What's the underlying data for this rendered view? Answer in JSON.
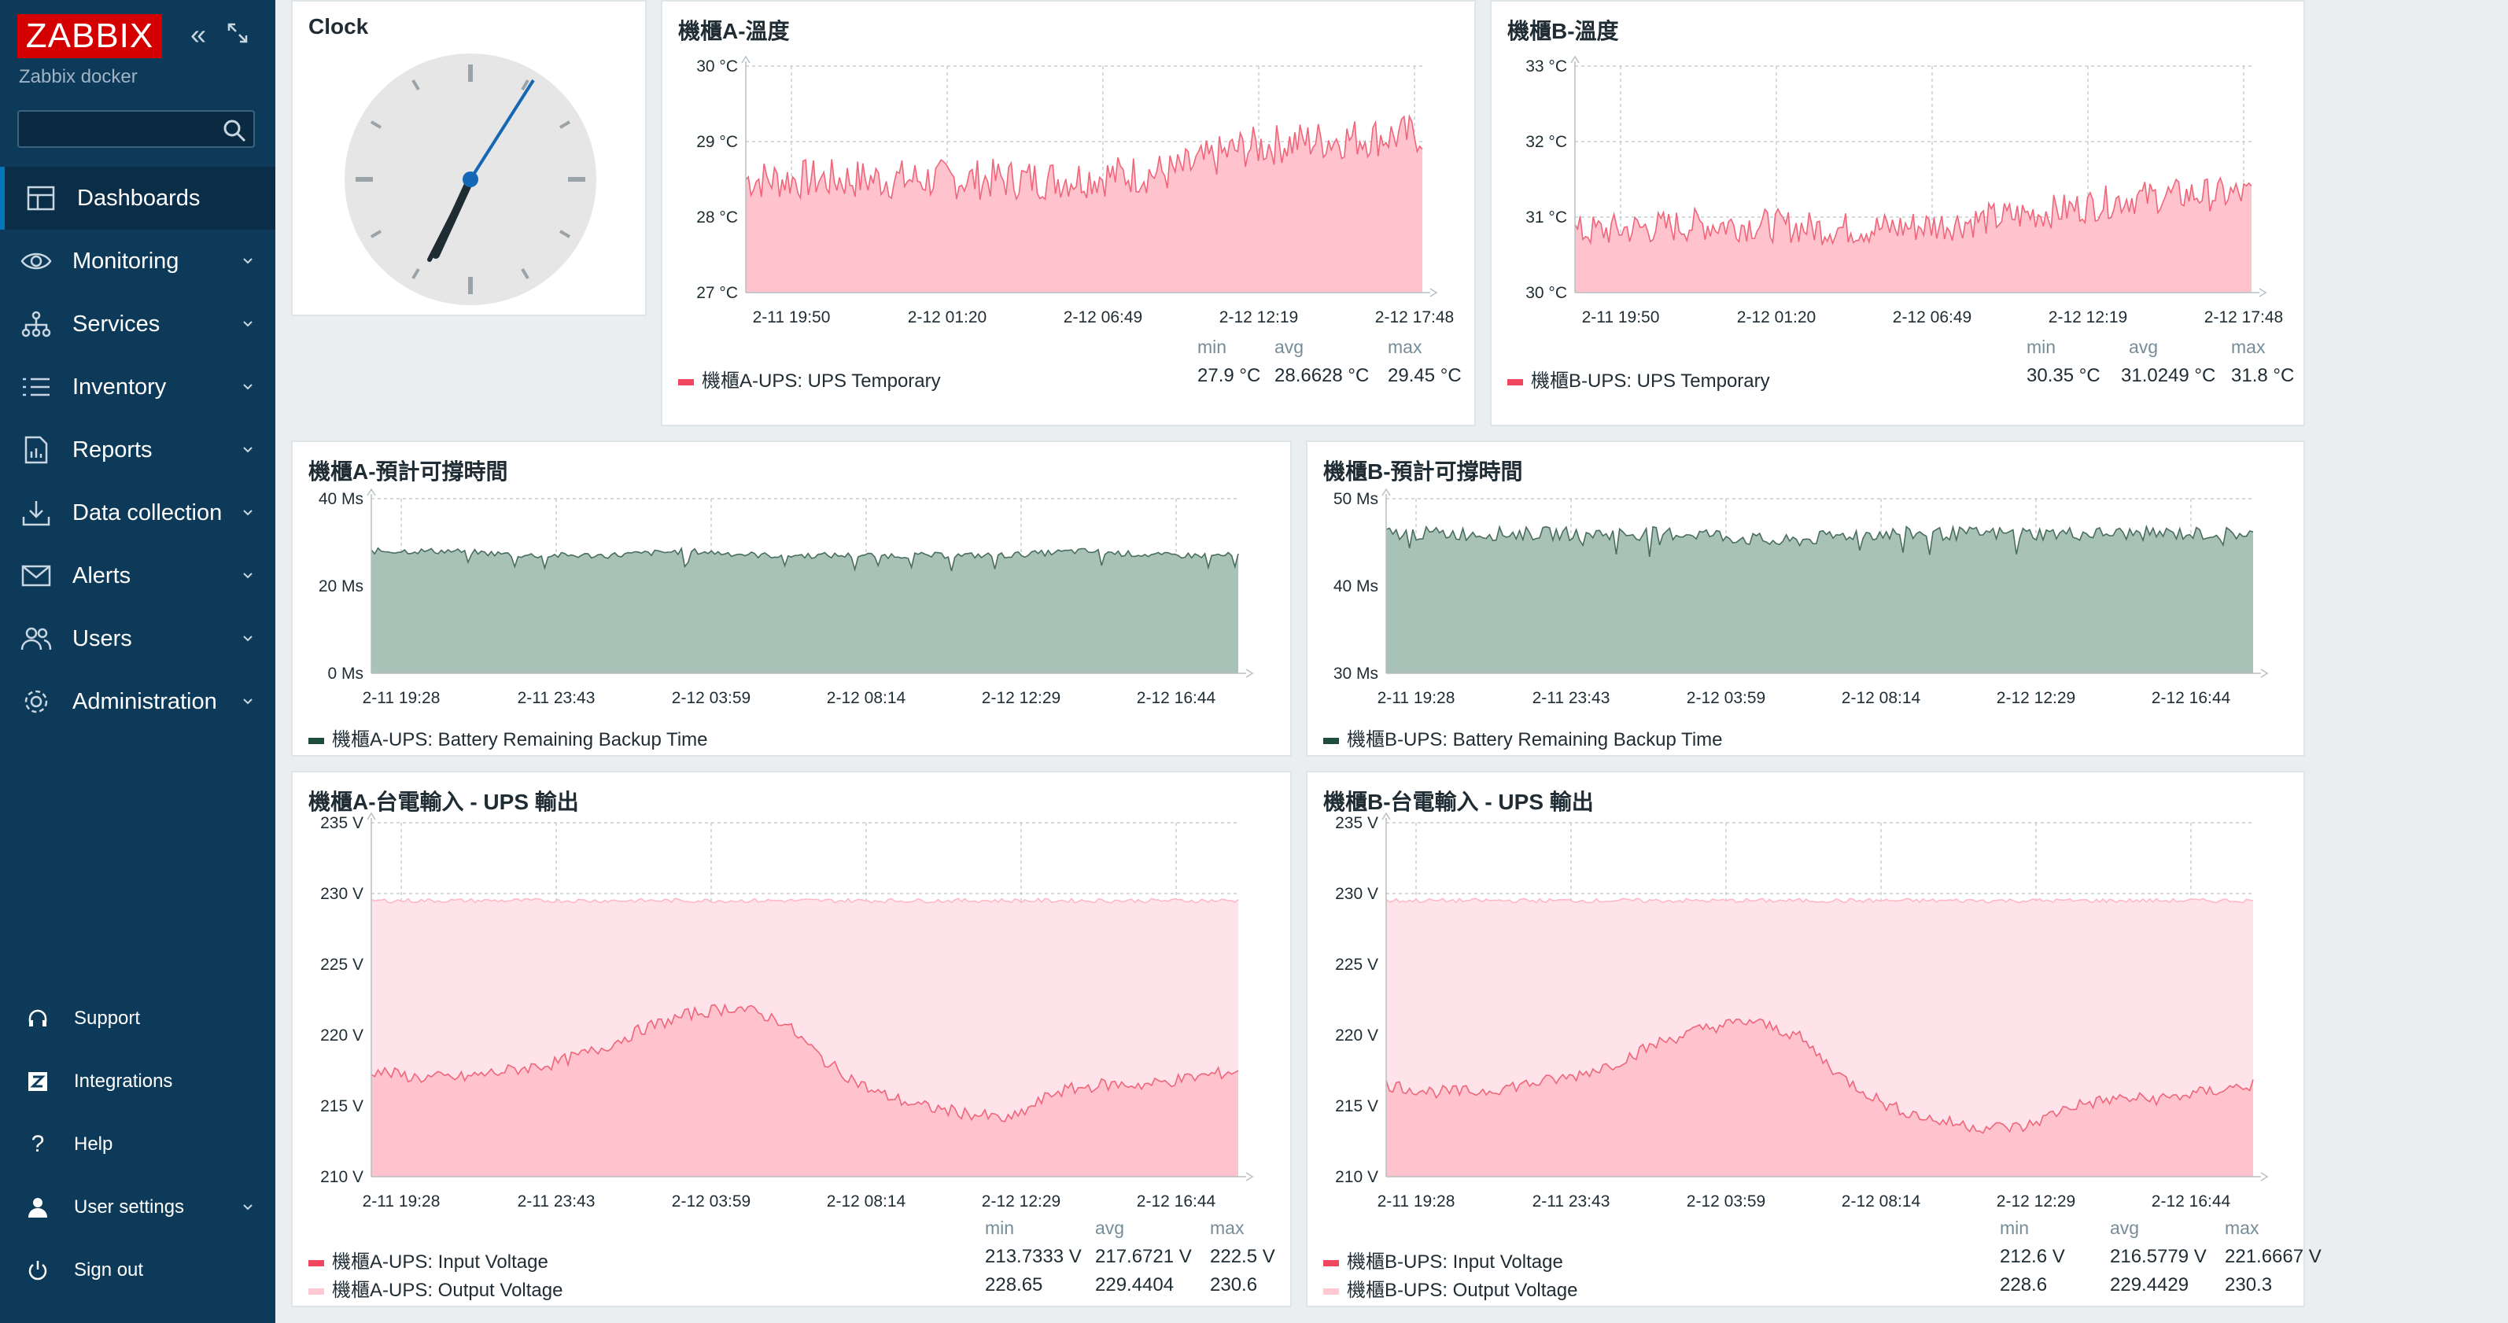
{
  "brand": {
    "logo": "ZABBIX",
    "server_name": "Zabbix docker"
  },
  "sidebar": {
    "search_placeholder": "",
    "menu": [
      {
        "label": "Dashboards",
        "icon": "dashboard-icon"
      },
      {
        "label": "Monitoring",
        "icon": "eye-icon"
      },
      {
        "label": "Services",
        "icon": "services-icon"
      },
      {
        "label": "Inventory",
        "icon": "list-icon"
      },
      {
        "label": "Reports",
        "icon": "report-icon"
      },
      {
        "label": "Data collection",
        "icon": "download-icon"
      },
      {
        "label": "Alerts",
        "icon": "envelope-icon"
      },
      {
        "label": "Users",
        "icon": "users-icon"
      },
      {
        "label": "Administration",
        "icon": "gear-icon"
      }
    ],
    "footer": [
      {
        "label": "Support",
        "icon": "headset-icon"
      },
      {
        "label": "Integrations",
        "icon": "integrations-icon"
      },
      {
        "label": "Help",
        "icon": "help-icon"
      },
      {
        "label": "User settings",
        "icon": "user-icon"
      },
      {
        "label": "Sign out",
        "icon": "power-icon"
      }
    ]
  },
  "colors": {
    "sidebar": "#0e3a5a",
    "accent_red": "#d40000",
    "temp_line": "#f0657a",
    "temp_fill": "#ffc3cd",
    "backup_line": "#4a6e5e",
    "backup_fill": "#a8c2b7",
    "output_fill": "#ffe3ea",
    "input_fill": "#ffc3cd"
  },
  "clock": {
    "title": "Clock"
  },
  "widgets": {
    "tempA": {
      "title": "機櫃A-溫度",
      "yticks": [
        "30 °C",
        "29 °C",
        "28 °C",
        "27 °C"
      ],
      "xticks": [
        "2-11 19:50",
        "2-12 01:20",
        "2-12 06:49",
        "2-12 12:19",
        "2-12 17:48"
      ],
      "legend": [
        "機櫃A-UPS: UPS Temporary"
      ],
      "stat_headers": [
        "min",
        "avg",
        "max"
      ],
      "stats": [
        [
          "27.9 °C",
          "28.6628 °C",
          "29.45 °C"
        ]
      ]
    },
    "tempB": {
      "title": "機櫃B-溫度",
      "yticks": [
        "33 °C",
        "32 °C",
        "31 °C",
        "30 °C"
      ],
      "xticks": [
        "2-11 19:50",
        "2-12 01:20",
        "2-12 06:49",
        "2-12 12:19",
        "2-12 17:48"
      ],
      "legend": [
        "機櫃B-UPS: UPS Temporary"
      ],
      "stat_headers": [
        "min",
        "avg",
        "max"
      ],
      "stats": [
        [
          "30.35 °C",
          "31.0249 °C",
          "31.8 °C"
        ]
      ]
    },
    "backupA": {
      "title": "機櫃A-預計可撐時間",
      "yticks": [
        "40 Ms",
        "20 Ms",
        "0 Ms"
      ],
      "xticks": [
        "2-11 19:28",
        "2-11 23:43",
        "2-12 03:59",
        "2-12 08:14",
        "2-12 12:29",
        "2-12 16:44"
      ],
      "legend": [
        "機櫃A-UPS: Battery Remaining Backup Time"
      ]
    },
    "backupB": {
      "title": "機櫃B-預計可撐時間",
      "yticks": [
        "50 Ms",
        "40 Ms",
        "30 Ms"
      ],
      "xticks": [
        "2-11 19:28",
        "2-11 23:43",
        "2-12 03:59",
        "2-12 08:14",
        "2-12 12:29",
        "2-12 16:44"
      ],
      "legend": [
        "機櫃B-UPS: Battery Remaining Backup Time"
      ]
    },
    "voltA": {
      "title": "機櫃A-台電輸入 - UPS 輸出",
      "yticks": [
        "235 V",
        "230 V",
        "225 V",
        "220 V",
        "215 V",
        "210 V"
      ],
      "xticks": [
        "2-11 19:28",
        "2-11 23:43",
        "2-12 03:59",
        "2-12 08:14",
        "2-12 12:29",
        "2-12 16:44"
      ],
      "legend": [
        "機櫃A-UPS: Input Voltage",
        "機櫃A-UPS: Output Voltage"
      ],
      "stat_headers": [
        "min",
        "avg",
        "max"
      ],
      "stats": [
        [
          "213.7333 V",
          "217.6721 V",
          "222.5 V"
        ],
        [
          "228.65",
          "229.4404",
          "230.6"
        ]
      ]
    },
    "voltB": {
      "title": "機櫃B-台電輸入 - UPS 輸出",
      "yticks": [
        "235 V",
        "230 V",
        "225 V",
        "220 V",
        "215 V",
        "210 V"
      ],
      "xticks": [
        "2-11 19:28",
        "2-11 23:43",
        "2-12 03:59",
        "2-12 08:14",
        "2-12 12:29",
        "2-12 16:44"
      ],
      "legend": [
        "機櫃B-UPS: Input Voltage",
        "機櫃B-UPS: Output Voltage"
      ],
      "stat_headers": [
        "min",
        "avg",
        "max"
      ],
      "stats": [
        [
          "212.6 V",
          "216.5779 V",
          "221.6667 V"
        ],
        [
          "228.6",
          "229.4429",
          "230.3"
        ]
      ]
    }
  },
  "chart_data": [
    {
      "type": "area",
      "title": "機櫃A-溫度",
      "ylim": [
        27,
        30
      ],
      "series": [
        {
          "name": "機櫃A-UPS: UPS Temporary",
          "values": [
            28.5,
            28.5,
            28.5,
            28.5,
            28.5,
            28.5,
            28.55,
            28.6,
            28.9,
            29.0,
            29.05,
            29.1
          ]
        }
      ],
      "x": [
        "2-11 19:50",
        "2-12 01:20",
        "2-12 06:49",
        "2-12 12:19",
        "2-12 17:48"
      ]
    },
    {
      "type": "area",
      "title": "機櫃B-溫度",
      "ylim": [
        30,
        33
      ],
      "series": [
        {
          "name": "機櫃B-UPS: UPS Temporary",
          "values": [
            30.8,
            30.85,
            30.9,
            30.9,
            30.85,
            30.85,
            30.9,
            31.0,
            31.1,
            31.25,
            31.3,
            31.3
          ]
        }
      ],
      "x": [
        "2-11 19:50",
        "2-12 01:20",
        "2-12 06:49",
        "2-12 12:19",
        "2-12 17:48"
      ]
    },
    {
      "type": "area",
      "title": "機櫃A-預計可撐時間",
      "ylim": [
        0,
        40
      ],
      "series": [
        {
          "name": "機櫃A-UPS: Battery Remaining Backup Time",
          "values": [
            28,
            28,
            27,
            27,
            28,
            27,
            27,
            27,
            27,
            28,
            27,
            27
          ]
        }
      ],
      "x": [
        "2-11 19:28",
        "2-11 23:43",
        "2-12 03:59",
        "2-12 08:14",
        "2-12 12:29",
        "2-12 16:44"
      ]
    },
    {
      "type": "area",
      "title": "機櫃B-預計可撐時間",
      "ylim": [
        30,
        50
      ],
      "series": [
        {
          "name": "機櫃B-UPS: Battery Remaining Backup Time",
          "values": [
            46,
            46,
            46,
            46,
            46,
            45,
            46,
            46,
            46,
            46,
            46,
            46
          ]
        }
      ],
      "x": [
        "2-11 19:28",
        "2-11 23:43",
        "2-12 03:59",
        "2-12 08:14",
        "2-12 12:29",
        "2-12 16:44"
      ]
    },
    {
      "type": "area",
      "title": "機櫃A-台電輸入 - UPS 輸出",
      "ylim": [
        210,
        235
      ],
      "series": [
        {
          "name": "機櫃A-UPS: Input Voltage",
          "values": [
            217.5,
            217,
            217,
            217.5,
            218,
            219,
            220.5,
            221.5,
            222,
            221,
            218,
            216,
            215,
            214.5,
            214,
            216,
            216.5,
            216.5,
            217,
            217.5
          ]
        },
        {
          "name": "機櫃A-UPS: Output Voltage",
          "values": [
            229.5,
            229.5,
            229.5,
            229.5,
            229.5,
            229.5,
            229.5,
            229.5,
            229.5,
            229.5,
            229.5,
            229.5,
            229.5,
            229.5,
            229.5,
            229.5,
            229.5,
            229.5,
            229.5,
            229.5
          ]
        }
      ],
      "x": [
        "2-11 19:28",
        "2-11 23:43",
        "2-12 03:59",
        "2-12 08:14",
        "2-12 12:29",
        "2-12 16:44"
      ]
    },
    {
      "type": "area",
      "title": "機櫃B-台電輸入 - UPS 輸出",
      "ylim": [
        210,
        235
      ],
      "series": [
        {
          "name": "機櫃B-UPS: Input Voltage",
          "values": [
            216.5,
            216,
            216,
            216.5,
            217,
            218,
            219.5,
            220.5,
            221,
            220,
            217,
            215,
            214,
            213.5,
            213.5,
            215,
            215.5,
            215.5,
            216,
            216.5
          ]
        },
        {
          "name": "機櫃B-UPS: Output Voltage",
          "values": [
            229.5,
            229.5,
            229.5,
            229.5,
            229.5,
            229.5,
            229.5,
            229.5,
            229.5,
            229.5,
            229.5,
            229.5,
            229.5,
            229.5,
            229.5,
            229.5,
            229.5,
            229.5,
            229.5,
            229.5
          ]
        }
      ],
      "x": [
        "2-11 19:28",
        "2-11 23:43",
        "2-12 03:59",
        "2-12 08:14",
        "2-12 12:29",
        "2-12 16:44"
      ]
    }
  ]
}
